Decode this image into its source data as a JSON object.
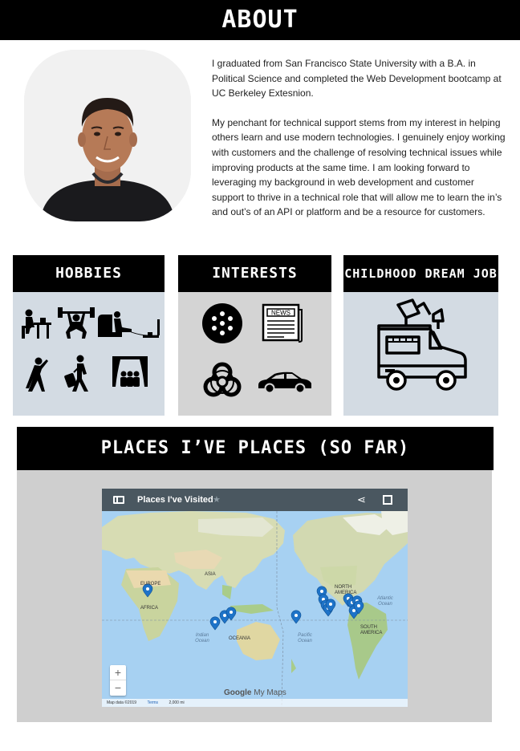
{
  "header": {
    "title": "ABOUT"
  },
  "bio": {
    "paragraph1": "I graduated from San Francisco State University with a B.A. in Political Science and completed the Web Development bootcamp at UC Berkeley Extesnion.",
    "paragraph2": "My penchant for technical support stems from my interest in helping others learn and use modern technologies. I genuinely enjoy working with customers and the challenge of resolving technical issues while improving products at the same time. I am looking forward to leveraging my background in web development and customer support to thrive in a technical role that will allow me to learn the in’s and out’s of an API or platform and be a resource for customers."
  },
  "cards": {
    "hobbies": {
      "title": "HOBBIES",
      "icons": [
        "dining-icon",
        "weightlifting-icon",
        "gaming-icon",
        "stretching-icon",
        "traveling-icon",
        "theater-icon"
      ]
    },
    "interests": {
      "title": "INTERESTS",
      "icons": [
        "warriors-logo-icon",
        "newspaper-icon",
        "biohazard-icon",
        "car-icon"
      ]
    },
    "dream_job": {
      "title": "CHILDHOOD DREAM JOB",
      "icons": [
        "food-truck-icon"
      ]
    }
  },
  "places": {
    "title": "PLACES I’VE PLACES (SO FAR)",
    "map": {
      "title": "Places I've Visited",
      "labels": {
        "asia": "ASIA",
        "europe": "EUROPE",
        "africa": "AFRICA",
        "oceania": "OCEANIA",
        "north_america": "NORTH AMERICA",
        "south_america": "SOUTH AMERICA",
        "indian_ocean": "Indian Ocean",
        "pacific_ocean": "Pacific Ocean",
        "atlantic_ocean": "Atlantic Ocean"
      },
      "zoom_in": "+",
      "zoom_out": "−",
      "logo_google": "Google",
      "logo_mymaps": "My Maps",
      "footer": {
        "data": "Map data ©2019",
        "terms": "Terms",
        "scale": "2,000 mi"
      },
      "pin_color": "#1e73c8"
    }
  },
  "colors": {
    "header_bg": "#000000",
    "card_bg": "#d3dbe3",
    "interests_bg": "#d4d4d4",
    "places_bg": "#cfcfcf",
    "ocean": "#a7d1f2"
  }
}
